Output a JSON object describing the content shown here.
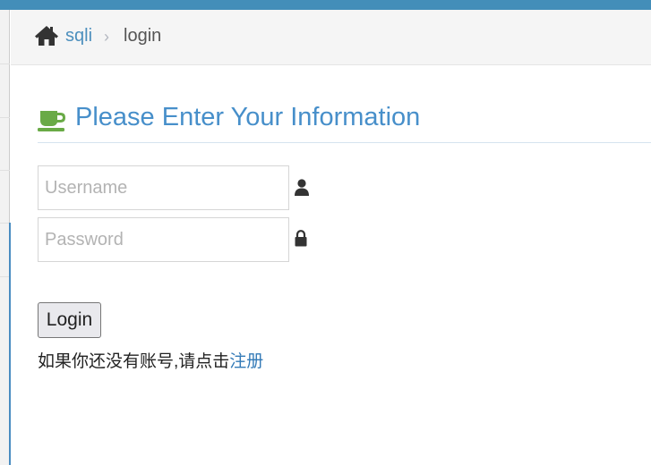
{
  "colors": {
    "topbar": "#438eb9",
    "link": "#4c8fbd",
    "heading": "#478fca",
    "coffee_icon": "#69aa46",
    "icon_dark": "#333333"
  },
  "breadcrumb": {
    "home_icon": "home-icon",
    "link_label": "sqli",
    "separator": "›",
    "current_label": "login"
  },
  "page": {
    "heading_icon": "coffee-icon",
    "heading": "Please Enter Your Information"
  },
  "form": {
    "username": {
      "value": "",
      "placeholder": "Username",
      "icon": "user-icon"
    },
    "password": {
      "value": "",
      "placeholder": "Password",
      "icon": "lock-icon"
    },
    "submit_label": "Login"
  },
  "register": {
    "prompt": "如果你还没有账号,请点击",
    "link_label": "注册"
  }
}
